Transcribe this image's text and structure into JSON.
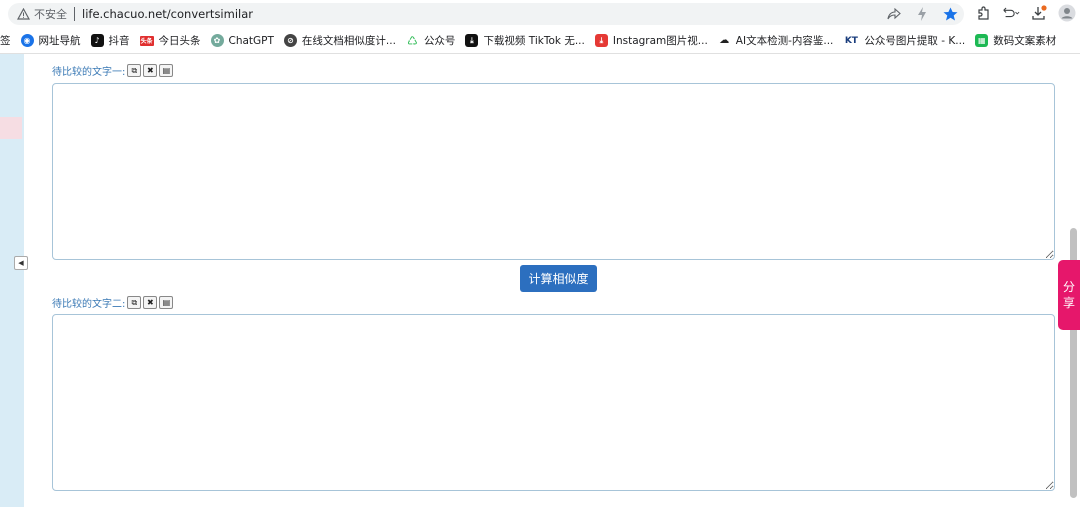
{
  "browser": {
    "insecure_label": "不安全",
    "url": "life.chacuo.net/convertsimilar"
  },
  "bookmarks": [
    {
      "label": "签",
      "icon": "bookmark-icon",
      "color": "#ffffff"
    },
    {
      "label": "网址导航",
      "icon": "nav-icon",
      "color": "#1a73e8"
    },
    {
      "label": "抖音",
      "icon": "tiktok-icon",
      "color": "#111111"
    },
    {
      "label": "今日头条",
      "icon": "toutiao-icon",
      "color": "#e02f2f"
    },
    {
      "label": "ChatGPT",
      "icon": "chatgpt-icon",
      "color": "#74aa9c"
    },
    {
      "label": "在线文档相似度计...",
      "icon": "similarity-icon",
      "color": "#444444"
    },
    {
      "label": "公众号",
      "icon": "wechat-icon",
      "color": "#2dbb55"
    },
    {
      "label": "下载视频 TikTok 无...",
      "icon": "download-icon",
      "color": "#111111"
    },
    {
      "label": "Instagram图片视...",
      "icon": "instagram-download-icon",
      "color": "#e53935"
    },
    {
      "label": "AI文本检测-内容鉴...",
      "icon": "ai-detect-icon",
      "color": "#222222"
    },
    {
      "label": "公众号图片提取 - K...",
      "icon": "kt-icon",
      "color": "#1a3d7c"
    },
    {
      "label": "数码文案素材",
      "icon": "material-icon",
      "color": "#1db954"
    }
  ],
  "form": {
    "text1_label": "待比较的文字一:",
    "text2_label": "待比较的文字二:",
    "text1_value": "",
    "text2_value": "",
    "calc_button": "计算相似度",
    "mini_buttons": [
      "copy",
      "clear",
      "paste"
    ]
  },
  "share": {
    "line1": "分",
    "line2": "享"
  },
  "colors": {
    "accent": "#2c6fbf",
    "label": "#3a79b5",
    "share": "#e6176b"
  }
}
